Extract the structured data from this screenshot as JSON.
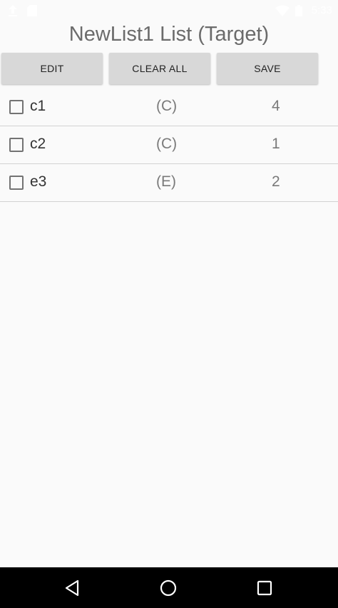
{
  "status_bar": {
    "time": "5:33",
    "left_icons": [
      "upload-icon",
      "sd-card-icon"
    ],
    "right_icons": [
      "wifi-icon",
      "battery-icon"
    ]
  },
  "page": {
    "title": "NewList1 List (Target)"
  },
  "toolbar": {
    "edit_label": "EDIT",
    "clear_all_label": "CLEAR ALL",
    "save_label": "SAVE"
  },
  "items": [
    {
      "name": "c1",
      "category": "(C)",
      "quantity": "4",
      "checked": false
    },
    {
      "name": "c2",
      "category": "(C)",
      "quantity": "1",
      "checked": false
    },
    {
      "name": "e3",
      "category": "(E)",
      "quantity": "2",
      "checked": false
    }
  ],
  "nav_bar": {
    "buttons": [
      "back-icon",
      "home-icon",
      "recents-icon"
    ]
  },
  "colors": {
    "background": "#fafafa",
    "button": "#d8d8d8",
    "nav_bar": "#000000",
    "divider": "#d2d2d2"
  }
}
